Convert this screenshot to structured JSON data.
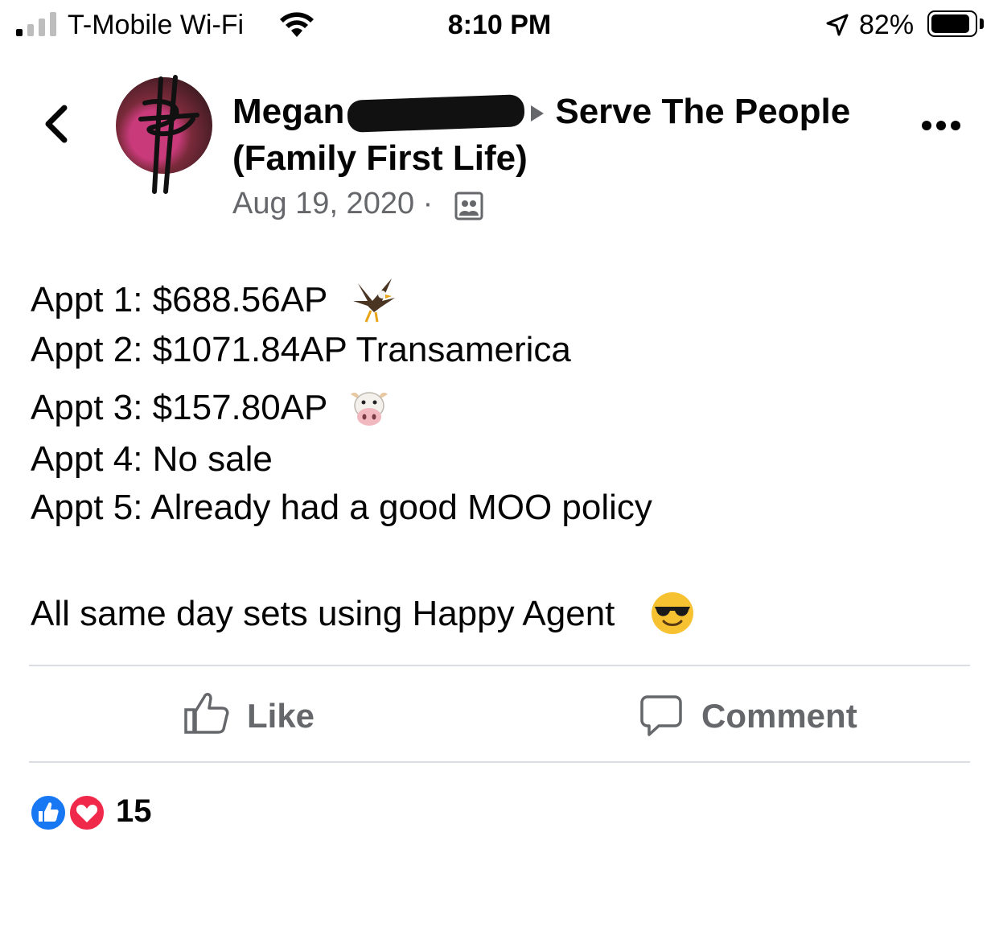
{
  "status_bar": {
    "carrier": "T-Mobile Wi-Fi",
    "time": "8:10 PM",
    "battery_percent": "82%",
    "battery_level": 0.82
  },
  "post": {
    "author": "Megan",
    "group": "Serve The People (Family First Life)",
    "date": "Aug 19, 2020",
    "separator": "·",
    "audience_icon": "group-members-icon",
    "lines": [
      "Appt 1: $688.56AP",
      "Appt 2: $1071.84AP Transamerica",
      "Appt 3: $157.80AP",
      "Appt 4: No sale",
      "Appt 5: Already had a good MOO policy",
      "All same day sets using Happy Agent"
    ],
    "emojis": [
      "eagle",
      "cow-face",
      "smiling-face-with-sunglasses"
    ]
  },
  "actions": {
    "like_label": "Like",
    "comment_label": "Comment"
  },
  "reactions": {
    "count": "15",
    "types": [
      "like",
      "love"
    ]
  },
  "colors": {
    "secondary_text": "#65676b",
    "divider": "#dadde1",
    "like_blue": "#1877f2",
    "love_red": "#f0284a"
  }
}
